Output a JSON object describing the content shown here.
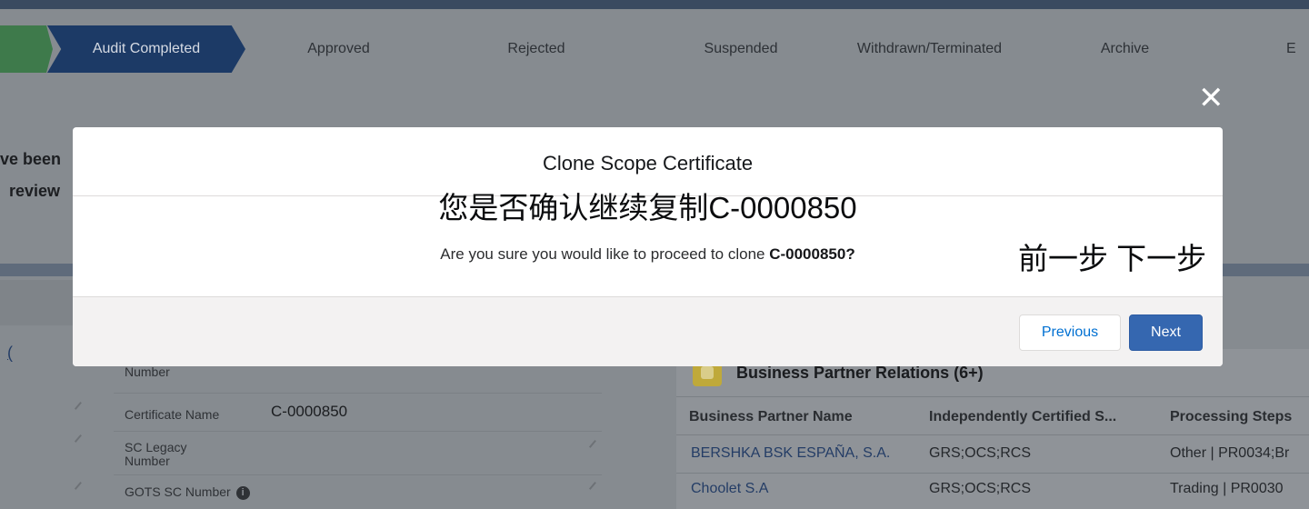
{
  "path": {
    "steps": [
      "Audit Completed",
      "Approved",
      "Rejected",
      "Suspended",
      "Withdrawn/Terminated",
      "Archive",
      "E"
    ],
    "current": "Audit Completed"
  },
  "background": {
    "text_line1": "ve been",
    "text_line2": "review",
    "link_fragment": "(",
    "fields": [
      {
        "label": "Number"
      },
      {
        "label": "Certificate Name",
        "value": "C-0000850"
      },
      {
        "label": "SC Legacy Number"
      },
      {
        "label": "GOTS SC Number"
      }
    ],
    "info_icon": "info-icon",
    "related": {
      "title": "Business Partner Relations (6+)",
      "columns": [
        "Business Partner Name",
        "Independently Certified S...",
        "Processing Steps"
      ],
      "rows": [
        [
          "BERSHKA BSK ESPAÑA, S.A.",
          "GRS;OCS;RCS",
          "Other | PR0034;Br"
        ],
        [
          "Choolet S.A",
          "GRS;OCS;RCS",
          "Trading | PR0030"
        ]
      ]
    }
  },
  "modal": {
    "close_icon": "close-icon",
    "title": "Clone Scope Certificate",
    "zh_title": "您是否确认继续复制C-0000850",
    "question_prefix": "Are you sure you would like to proceed to clone ",
    "question_id": "C-0000850?",
    "zh_buttons": "前一步 下一步",
    "previous_label": "Previous",
    "next_label": "Next"
  },
  "colors": {
    "path_current": "#1c3a66",
    "path_done": "#3e7a4b",
    "next_button": "#3567b0",
    "link": "#0070d2"
  }
}
